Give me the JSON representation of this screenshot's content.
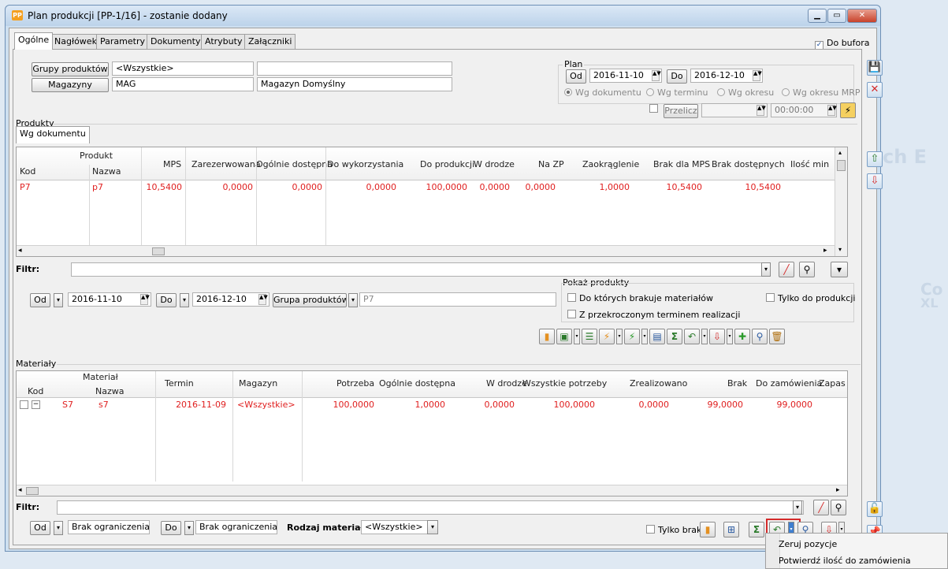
{
  "window": {
    "title": "Plan produkcji [PP-1/16] - zostanie dodany",
    "icon_text": "PP"
  },
  "tabs": [
    {
      "label": "Ogólne"
    },
    {
      "label": "Nagłówek"
    },
    {
      "label": "Parametry"
    },
    {
      "label": "Dokumenty"
    },
    {
      "label": "Atrybuty"
    },
    {
      "label": "Załączniki"
    }
  ],
  "do_bufora": {
    "label": "Do bufora",
    "checked": true
  },
  "top": {
    "grupy_btn": "Grupy produktów",
    "grupy_value": "<Wszystkie>",
    "grupy_desc": "",
    "magazyny_btn": "Magazyny",
    "magazyny_value": "MAG",
    "magazyny_desc": "Magazyn Domyślny"
  },
  "plan": {
    "label": "Plan",
    "od_btn": "Od",
    "od_value": "2016-11-10",
    "do_btn": "Do",
    "do_value": "2016-12-10",
    "radios": [
      "Wg dokumentu",
      "Wg terminu",
      "Wg okresu",
      "Wg okresu MRP"
    ],
    "przelicz": "Przelicz",
    "time": "00:00:00"
  },
  "produkty": {
    "section_label": "Produkty",
    "subtab": "Wg dokumentu",
    "group_header": "Produkt",
    "columns": [
      "Kod",
      "Nazwa",
      "MPS",
      "Zarezerwowana",
      "Ogólnie dostępna",
      "Do wykorzystania",
      "Do produkcji",
      "W drodze",
      "Na ZP",
      "Zaokrąglenie",
      "Brak dla MPS",
      "Brak dostępnych",
      "Ilość min"
    ],
    "rows": [
      [
        "P7",
        "p7",
        "10,5400",
        "0,0000",
        "0,0000",
        "0,0000",
        "100,0000",
        "0,0000",
        "0,0000",
        "1,0000",
        "10,5400",
        "10,5400",
        ""
      ]
    ],
    "filter_label": "Filtr:",
    "od_btn": "Od",
    "od_value": "2016-11-10",
    "do_btn": "Do",
    "do_value": "2016-12-10",
    "grupa_btn": "Grupa produktów",
    "grupa_value": "P7",
    "pokaz_label": "Pokaż produkty",
    "pokaz_opts": [
      "Do których brakuje materiałów",
      "Z przekroczonym terminem realizacji",
      "Tylko do produkcji"
    ]
  },
  "materialy": {
    "section_label": "Materiały",
    "group_header": "Materiał",
    "columns": [
      "Kod",
      "Nazwa",
      "Termin",
      "Magazyn",
      "Potrzeba",
      "Ogólnie dostępna",
      "W drodze",
      "Wszystkie potrzeby",
      "Zrealizowano",
      "Brak",
      "Do zamówienia",
      "Zapas"
    ],
    "rows": [
      [
        "S7",
        "s7",
        "2016-11-09",
        "<Wszystkie>",
        "100,0000",
        "1,0000",
        "0,0000",
        "100,0000",
        "0,0000",
        "99,0000",
        "99,0000",
        ""
      ]
    ],
    "filter_label": "Filtr:",
    "od_btn": "Od",
    "od_value": "Brak ograniczenia",
    "do_btn": "Do",
    "do_value": "Brak ograniczenia",
    "rodzaj_label": "Rodzaj materiału:",
    "rodzaj_value": "<Wszystkie>",
    "tylko_braki": "Tylko braki"
  },
  "context_menu": {
    "items": [
      "Zeruj pozycje",
      "Potwierdź ilość do zamówienia"
    ]
  },
  "watermark": {
    "text": "ch E",
    "text2": "Co",
    "text3": "XL"
  },
  "colors": {
    "row_text": "#e02020",
    "title_bg": "#c4d8ee",
    "accent_red": "#d42a2a"
  }
}
